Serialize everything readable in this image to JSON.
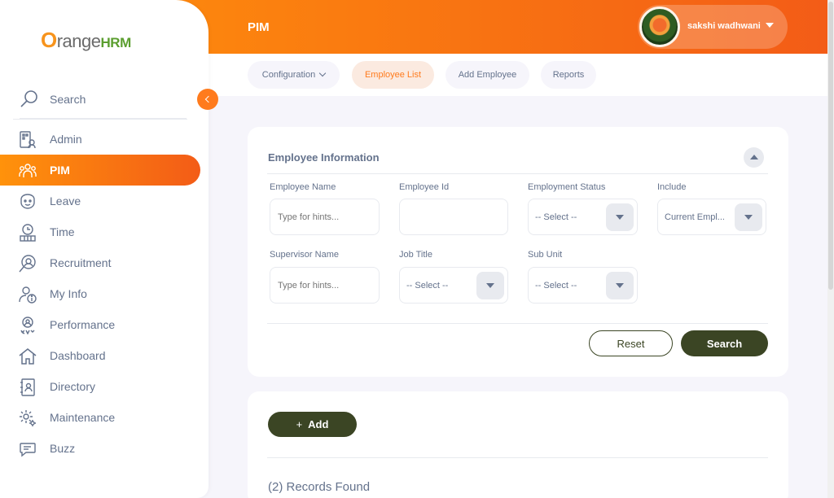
{
  "header": {
    "title": "PIM",
    "user_name": "sakshi wadhwani"
  },
  "subnav": {
    "tabs": [
      {
        "label": "Configuration"
      },
      {
        "label": "Employee List"
      },
      {
        "label": "Add Employee"
      },
      {
        "label": "Reports"
      }
    ],
    "active_tab": "Employee List"
  },
  "sidebar": {
    "logo_o": "O",
    "logo_text": "range",
    "logo_hrm": "HRM",
    "search_label": "Search",
    "items": [
      {
        "label": "Admin",
        "icon": "admin-icon"
      },
      {
        "label": "PIM",
        "icon": "pim-icon"
      },
      {
        "label": "Leave",
        "icon": "leave-icon"
      },
      {
        "label": "Time",
        "icon": "time-icon"
      },
      {
        "label": "Recruitment",
        "icon": "recruitment-icon"
      },
      {
        "label": "My Info",
        "icon": "my-info-icon"
      },
      {
        "label": "Performance",
        "icon": "performance-icon"
      },
      {
        "label": "Dashboard",
        "icon": "dashboard-icon"
      },
      {
        "label": "Directory",
        "icon": "directory-icon"
      },
      {
        "label": "Maintenance",
        "icon": "maintenance-icon"
      },
      {
        "label": "Buzz",
        "icon": "buzz-icon"
      }
    ],
    "active_item": "PIM"
  },
  "filter": {
    "title": "Employee Information",
    "employee_name_label": "Employee Name",
    "employee_name_placeholder": "Type for hints...",
    "employee_id_label": "Employee Id",
    "employment_status_label": "Employment Status",
    "employment_status_value": "-- Select --",
    "include_label": "Include",
    "include_value": "Current Empl...",
    "supervisor_label": "Supervisor Name",
    "supervisor_placeholder": "Type for hints...",
    "job_title_label": "Job Title",
    "job_title_value": "-- Select --",
    "sub_unit_label": "Sub Unit",
    "sub_unit_value": "-- Select --",
    "reset_label": "Reset",
    "search_label": "Search"
  },
  "list": {
    "add_label": "Add",
    "records_found": "(2) Records Found"
  },
  "colors": {
    "accent": "#ff7b1d",
    "primary_button": "#3b4524",
    "text": "#64728c"
  }
}
